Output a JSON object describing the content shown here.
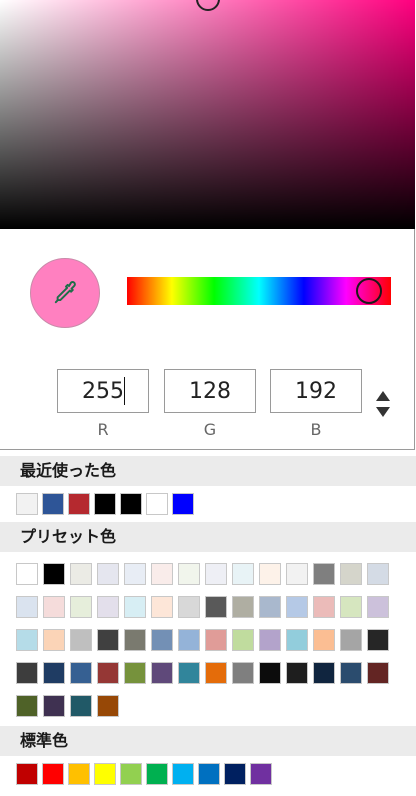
{
  "picker": {
    "selected_color": "#ff80c0",
    "hue_color": "#ff007f",
    "eyedropper_icon": "eyedropper-icon",
    "rgb": {
      "r_value": "255",
      "g_value": "128",
      "b_value": "192",
      "r_label": "R",
      "g_label": "G",
      "b_label": "B"
    },
    "mode_toggle_icon": "up-down-triangle-icon"
  },
  "recent": {
    "title": "最近使った色",
    "colors": [
      "#f2f2f2",
      "#2e5597",
      "#b5292f",
      "#000000",
      "#000000",
      "#ffffff",
      "#0000ff"
    ]
  },
  "presets": {
    "title": "プリセット色",
    "colors": [
      "#ffffff",
      "#000000",
      "#ebebe5",
      "#e5e6ef",
      "#e8edf5",
      "#f9ecea",
      "#f1f5ec",
      "#eeeff5",
      "#e8f3f6",
      "#fdf2e9",
      "#f2f2f2",
      "#7f7f7f",
      "#d5d5cb",
      "#d4dbe5",
      "#dae3ef",
      "#f5dcdb",
      "#e6eedb",
      "#e3dfeb",
      "#d7eef4",
      "#fde6d8",
      "#d8d8d8",
      "#595959",
      "#afaea2",
      "#a9b8cd",
      "#b5c9e6",
      "#ebbbb9",
      "#d6e6bf",
      "#ccc1db",
      "#b5dce8",
      "#fbd4b7",
      "#bfbfbf",
      "#404040",
      "#7a7a6f",
      "#7390b5",
      "#94b3d8",
      "#e09c98",
      "#c0dc9e",
      "#b3a3cb",
      "#92cddc",
      "#fbbe93",
      "#a5a5a5",
      "#262626",
      "#3d3d3d",
      "#1f3c63",
      "#366092",
      "#953735",
      "#76923c",
      "#5f497a",
      "#31859b",
      "#e46c0a",
      "#7f7f7f",
      "#0c0c0c",
      "#1e1e1e",
      "#10253f",
      "#2b4c6e",
      "#632523",
      "#4f6228",
      "#3f3151",
      "#215967",
      "#974806"
    ]
  },
  "standard": {
    "title": "標準色",
    "colors": [
      "#c00000",
      "#ff0000",
      "#ffc000",
      "#ffff00",
      "#92d050",
      "#00b050",
      "#00b0f0",
      "#0070c0",
      "#002060",
      "#7030a0"
    ]
  }
}
